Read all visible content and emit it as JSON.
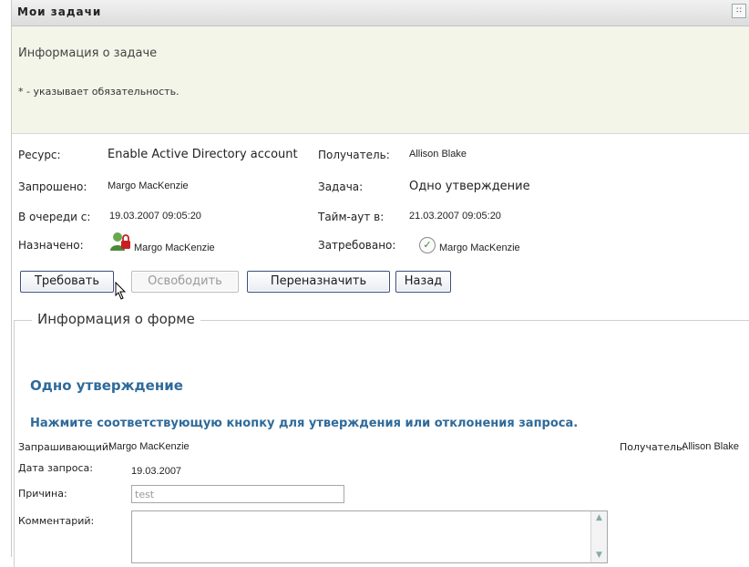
{
  "portlet": {
    "title": "Мои задачи",
    "menu_icon": "grid-icon"
  },
  "info": {
    "heading": "Информация о задаче",
    "required_note": "* - указывает обязательность."
  },
  "task": {
    "resource_label": "Ресурс:",
    "resource_value": "Enable Active Directory account",
    "recipient_label": "Получатель:",
    "recipient_value": "Allison Blake",
    "requested_label": "Запрошено:",
    "requested_value": "Margo MacKenzie",
    "task_label": "Задача:",
    "task_value": "Одно утверждение",
    "queued_label": "В очереди с:",
    "queued_value": "19.03.2007 09:05:20",
    "timeout_label": "Тайм-аут в:",
    "timeout_value": "21.03.2007 09:05:20",
    "assigned_label": "Назначено:",
    "assigned_value": "Margo MacKenzie",
    "claimed_label": "Затребовано:",
    "claimed_value": "Margo MacKenzie"
  },
  "buttons": {
    "claim": "Требовать",
    "release": "Освободить",
    "reassign": "Переназначить",
    "back": "Назад"
  },
  "form": {
    "legend": "Информация о форме",
    "title": "Одно утверждение",
    "instruction": "Нажмите соответствующую кнопку для утверждения или отклонения запроса.",
    "requester_label": "Запрашивающий:",
    "requester_value": "Margo MacKenzie",
    "recipient_label": "Получатель:",
    "recipient_value": "Allison Blake",
    "date_label": "Дата запроса:",
    "date_value": "19.03.2007",
    "reason_label": "Причина:",
    "reason_value": "test",
    "comment_label": "Комментарий:"
  },
  "colors": {
    "info_bg": "#f4f5e9",
    "heading_blue": "#2f6a9a"
  }
}
